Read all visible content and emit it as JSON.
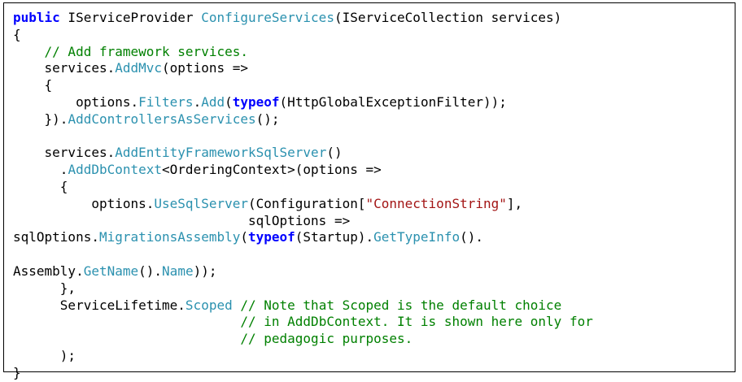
{
  "colors": {
    "keyword": "#0000ff",
    "method": "#2b91af",
    "comment": "#008000",
    "string": "#a31515",
    "text": "#000000",
    "border": "#000000",
    "background": "#ffffff"
  },
  "lines": [
    [
      {
        "cls": "kw",
        "text": "public"
      },
      {
        "cls": "type",
        "text": " IServiceProvider "
      },
      {
        "cls": "method",
        "text": "ConfigureServices"
      },
      {
        "cls": "punct",
        "text": "(IServiceCollection services)"
      }
    ],
    [
      {
        "cls": "punct",
        "text": "{"
      }
    ],
    [
      {
        "cls": "punct",
        "text": "    "
      },
      {
        "cls": "comment",
        "text": "// Add framework services."
      }
    ],
    [
      {
        "cls": "punct",
        "text": "    services."
      },
      {
        "cls": "method",
        "text": "AddMvc"
      },
      {
        "cls": "punct",
        "text": "(options =>"
      }
    ],
    [
      {
        "cls": "punct",
        "text": "    {"
      }
    ],
    [
      {
        "cls": "punct",
        "text": "        options."
      },
      {
        "cls": "method",
        "text": "Filters"
      },
      {
        "cls": "punct",
        "text": "."
      },
      {
        "cls": "method",
        "text": "Add"
      },
      {
        "cls": "punct",
        "text": "("
      },
      {
        "cls": "kw",
        "text": "typeof"
      },
      {
        "cls": "punct",
        "text": "(HttpGlobalExceptionFilter));"
      }
    ],
    [
      {
        "cls": "punct",
        "text": "    })."
      },
      {
        "cls": "method",
        "text": "AddControllersAsServices"
      },
      {
        "cls": "punct",
        "text": "();"
      }
    ],
    [
      {
        "cls": "punct",
        "text": ""
      }
    ],
    [
      {
        "cls": "punct",
        "text": "    services."
      },
      {
        "cls": "method",
        "text": "AddEntityFrameworkSqlServer"
      },
      {
        "cls": "punct",
        "text": "()"
      }
    ],
    [
      {
        "cls": "punct",
        "text": "      ."
      },
      {
        "cls": "method",
        "text": "AddDbContext"
      },
      {
        "cls": "punct",
        "text": "<OrderingContext>(options =>"
      }
    ],
    [
      {
        "cls": "punct",
        "text": "      {"
      }
    ],
    [
      {
        "cls": "punct",
        "text": "          options."
      },
      {
        "cls": "method",
        "text": "UseSqlServer"
      },
      {
        "cls": "punct",
        "text": "(Configuration["
      },
      {
        "cls": "string",
        "text": "\"ConnectionString\""
      },
      {
        "cls": "punct",
        "text": "],"
      }
    ],
    [
      {
        "cls": "punct",
        "text": "                              sqlOptions =>"
      }
    ],
    [
      {
        "cls": "punct",
        "text": "sqlOptions."
      },
      {
        "cls": "method",
        "text": "MigrationsAssembly"
      },
      {
        "cls": "punct",
        "text": "("
      },
      {
        "cls": "kw",
        "text": "typeof"
      },
      {
        "cls": "punct",
        "text": "(Startup)."
      },
      {
        "cls": "method",
        "text": "GetTypeInfo"
      },
      {
        "cls": "punct",
        "text": "()."
      }
    ],
    [
      {
        "cls": "punct",
        "text": ""
      }
    ],
    [
      {
        "cls": "punct",
        "text": "Assembly."
      },
      {
        "cls": "method",
        "text": "GetName"
      },
      {
        "cls": "punct",
        "text": "()."
      },
      {
        "cls": "method",
        "text": "Name"
      },
      {
        "cls": "punct",
        "text": "));"
      }
    ],
    [
      {
        "cls": "punct",
        "text": "      },"
      }
    ],
    [
      {
        "cls": "punct",
        "text": "      ServiceLifetime."
      },
      {
        "cls": "method",
        "text": "Scoped"
      },
      {
        "cls": "punct",
        "text": " "
      },
      {
        "cls": "comment",
        "text": "// Note that Scoped is the default choice"
      }
    ],
    [
      {
        "cls": "punct",
        "text": "                             "
      },
      {
        "cls": "comment",
        "text": "// in AddDbContext. It is shown here only for"
      }
    ],
    [
      {
        "cls": "punct",
        "text": "                             "
      },
      {
        "cls": "comment",
        "text": "// pedagogic purposes."
      }
    ],
    [
      {
        "cls": "punct",
        "text": "      );"
      }
    ],
    [
      {
        "cls": "punct",
        "text": "}"
      }
    ]
  ]
}
